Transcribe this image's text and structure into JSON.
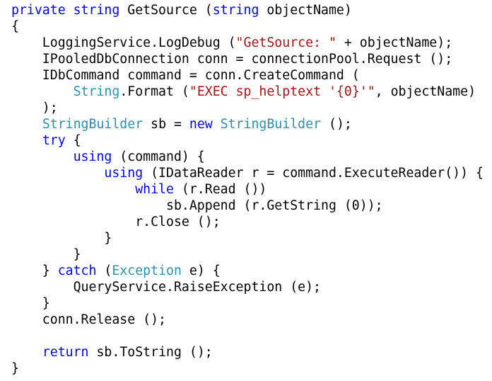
{
  "code": {
    "lines": [
      [
        {
          "t": "private",
          "k": "kw"
        },
        {
          "t": " "
        },
        {
          "t": "string",
          "k": "kw"
        },
        {
          "t": " GetSource ("
        },
        {
          "t": "string",
          "k": "kw"
        },
        {
          "t": " objectName)"
        }
      ],
      [
        {
          "t": "{"
        }
      ],
      [
        {
          "t": "    LoggingService.LogDebug ("
        },
        {
          "t": "\"GetSource: \"",
          "k": "str"
        },
        {
          "t": " + objectName);"
        }
      ],
      [
        {
          "t": "    IPooledDbConnection conn = connectionPool.Request ();"
        }
      ],
      [
        {
          "t": "    IDbCommand command = conn.CreateCommand ("
        }
      ],
      [
        {
          "t": "        "
        },
        {
          "t": "String",
          "k": "type"
        },
        {
          "t": ".Format ("
        },
        {
          "t": "\"EXEC sp_helptext '{0}'\"",
          "k": "str"
        },
        {
          "t": ", objectName)"
        }
      ],
      [
        {
          "t": "    );"
        }
      ],
      [
        {
          "t": "    "
        },
        {
          "t": "StringBuilder",
          "k": "type"
        },
        {
          "t": " sb = "
        },
        {
          "t": "new",
          "k": "kw"
        },
        {
          "t": " "
        },
        {
          "t": "StringBuilder",
          "k": "type"
        },
        {
          "t": " ();"
        }
      ],
      [
        {
          "t": "    "
        },
        {
          "t": "try",
          "k": "kw"
        },
        {
          "t": " {"
        }
      ],
      [
        {
          "t": "        "
        },
        {
          "t": "using",
          "k": "kw"
        },
        {
          "t": " (command) {"
        }
      ],
      [
        {
          "t": "            "
        },
        {
          "t": "using",
          "k": "kw"
        },
        {
          "t": " (IDataReader r = command.ExecuteReader()) {"
        }
      ],
      [
        {
          "t": "                "
        },
        {
          "t": "while",
          "k": "kw"
        },
        {
          "t": " (r.Read ())"
        }
      ],
      [
        {
          "t": "                    sb.Append (r.GetString (0));"
        }
      ],
      [
        {
          "t": "                r.Close ();"
        }
      ],
      [
        {
          "t": "            }"
        }
      ],
      [
        {
          "t": "        }"
        }
      ],
      [
        {
          "t": "    } "
        },
        {
          "t": "catch",
          "k": "kw"
        },
        {
          "t": " ("
        },
        {
          "t": "Exception",
          "k": "type"
        },
        {
          "t": " e) {"
        }
      ],
      [
        {
          "t": "        QueryService.RaiseException (e);"
        }
      ],
      [
        {
          "t": "    }"
        }
      ],
      [
        {
          "t": "    conn.Release ();"
        }
      ],
      [],
      [
        {
          "t": "    "
        },
        {
          "t": "return",
          "k": "kw"
        },
        {
          "t": " sb.ToString ();"
        }
      ],
      [
        {
          "t": "}"
        }
      ]
    ]
  }
}
